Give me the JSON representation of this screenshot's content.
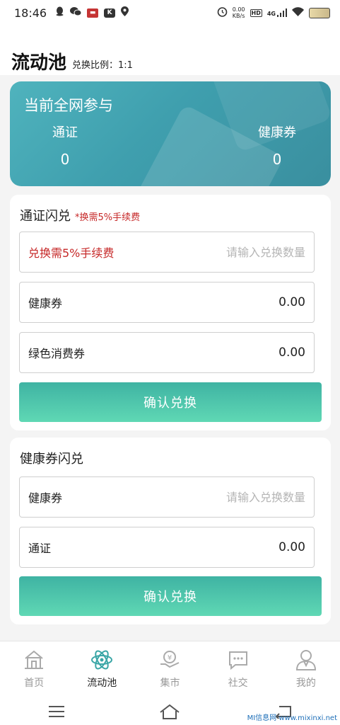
{
  "status_bar": {
    "time": "18:46",
    "net_speed_value": "0.00",
    "net_speed_unit": "KB/s",
    "hd": "HD",
    "network": "4G"
  },
  "header": {
    "title": "流动池",
    "ratio": "兑换比例：1:1"
  },
  "banner": {
    "title": "当前全网参与",
    "left_label": "通证",
    "left_value": "0",
    "right_label": "健康券",
    "right_value": "0"
  },
  "card1": {
    "title": "通证闪兑",
    "note": "*换需5%手续费",
    "input_label": "兑换需5%手续费",
    "input_placeholder": "请输入兑换数量",
    "row2_label": "健康券",
    "row2_value": "0.00",
    "row3_label": "绿色消费券",
    "row3_value": "0.00",
    "button": "确认兑换"
  },
  "card2": {
    "title": "健康券闪兑",
    "input_label": "健康券",
    "input_placeholder": "请输入兑换数量",
    "row2_label": "通证",
    "row2_value": "0.00",
    "button": "确认兑换"
  },
  "bottom_nav": {
    "items": [
      {
        "label": "首页",
        "icon": "home-icon",
        "active": false
      },
      {
        "label": "流动池",
        "icon": "atom-icon",
        "active": true
      },
      {
        "label": "集市",
        "icon": "market-icon",
        "active": false
      },
      {
        "label": "社交",
        "icon": "chat-icon",
        "active": false
      },
      {
        "label": "我的",
        "icon": "profile-icon",
        "active": false
      }
    ]
  },
  "watermark": "MI信息网 www.mixinxi.net",
  "colors": {
    "accent_teal": "#3f9fae",
    "button_gradient_start": "#3fb3a3",
    "button_gradient_end": "#5fd8b4",
    "warning_red": "#c62828"
  }
}
